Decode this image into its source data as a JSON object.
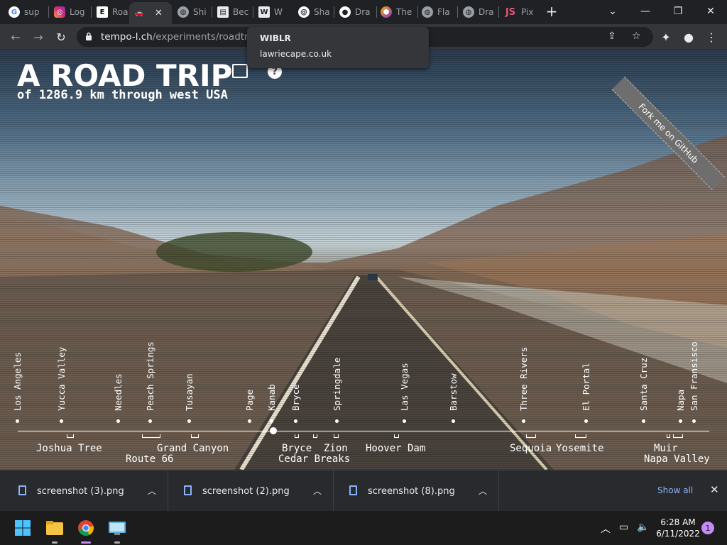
{
  "browser": {
    "tabs": [
      {
        "label": "sup",
        "icon": "google-icon"
      },
      {
        "label": "Log",
        "icon": "instagram-icon"
      },
      {
        "label": "Roa",
        "icon": "e-icon"
      },
      {
        "label": "",
        "icon": "car-icon",
        "active": true
      },
      {
        "label": "Shi",
        "icon": "globe-icon"
      },
      {
        "label": "Bec",
        "icon": "page-icon"
      },
      {
        "label": "W",
        "icon": "w-icon"
      },
      {
        "label": "Sha",
        "icon": "swirl-icon"
      },
      {
        "label": "Dra",
        "icon": "github-icon"
      },
      {
        "label": "The",
        "icon": "hex-icon"
      },
      {
        "label": "Fla",
        "icon": "globe-icon"
      },
      {
        "label": "Dra",
        "icon": "globe-icon"
      },
      {
        "label": "Pix",
        "icon": "js-icon"
      }
    ],
    "url_host": "tempo-l.ch",
    "url_path": "/experiments/roadtrip/",
    "tooltip": {
      "title": "WIBLR",
      "host": "lawriecape.co.uk"
    }
  },
  "page": {
    "title": "A ROAD TRIP",
    "subtitle": "of 1286.9 km through west USA",
    "fork_ribbon": "Fork me on GitHub",
    "help_symbol": "?",
    "cities": [
      "Los Angeles",
      "Yucca Valley",
      "Needles",
      "Peach Springs",
      "Tusayan",
      "Page",
      "Kanab",
      "Bryce",
      "Springdale",
      "Las Vegas",
      "Barstow",
      "Three Rivers",
      "El Portal",
      "Santa Cruz",
      "Napa",
      "San Fransisco"
    ],
    "regions_row1": [
      "Joshua Tree",
      "Grand Canyon",
      "Bryce",
      "Zion",
      "Hoover Dam",
      "Sequoia",
      "Yosemite",
      "Muir"
    ],
    "regions_row2": [
      "Route 66",
      "Cedar Breaks",
      "Napa Valley"
    ]
  },
  "downloads": {
    "items": [
      "screenshot (3).png",
      "screenshot (2).png",
      "screenshot (8).png"
    ],
    "show_all": "Show all"
  },
  "taskbar": {
    "time": "6:28 AM",
    "date": "6/11/2022",
    "notifications": "1"
  }
}
